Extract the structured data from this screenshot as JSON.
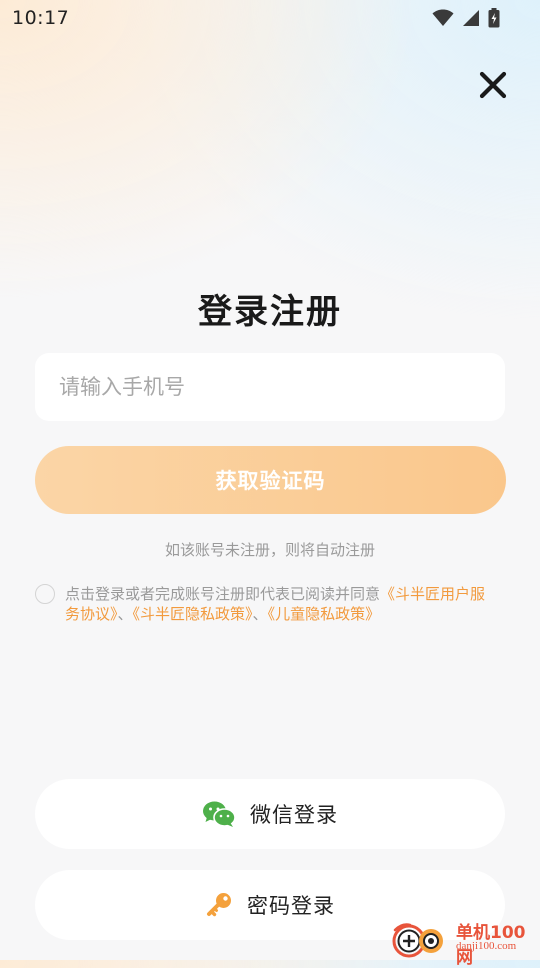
{
  "status_bar": {
    "time": "10:17",
    "icons": [
      "wifi-icon",
      "signal-icon",
      "battery-charging-icon"
    ]
  },
  "close_icon": "close-icon",
  "title": "登录注册",
  "phone": {
    "placeholder": "请输入手机号",
    "value": ""
  },
  "get_code_button": "获取验证码",
  "hint": "如该账号未注册，则将自动注册",
  "agreement": {
    "checked": false,
    "prefix": "点击登录或者完成账号注册即代表已阅读并同意",
    "link_service": "《斗半匠用户服务协议》",
    "sep1": "、",
    "link_privacy": "《斗半匠隐私政策》",
    "sep2": "、",
    "link_child_privacy": "《儿童隐私政策》"
  },
  "wechat_login": {
    "label": "微信登录",
    "icon": "wechat-icon"
  },
  "password_login": {
    "label": "密码登录",
    "icon": "key-icon"
  },
  "watermark": {
    "name": "单机100网",
    "domain": "danji100.com"
  },
  "colors": {
    "accent_orange": "#f29a3d",
    "button_gradient_start": "#fbd5a6",
    "button_gradient_end": "#fac78c",
    "wechat_green": "#4eb04a",
    "key_orange": "#f4a13c"
  }
}
